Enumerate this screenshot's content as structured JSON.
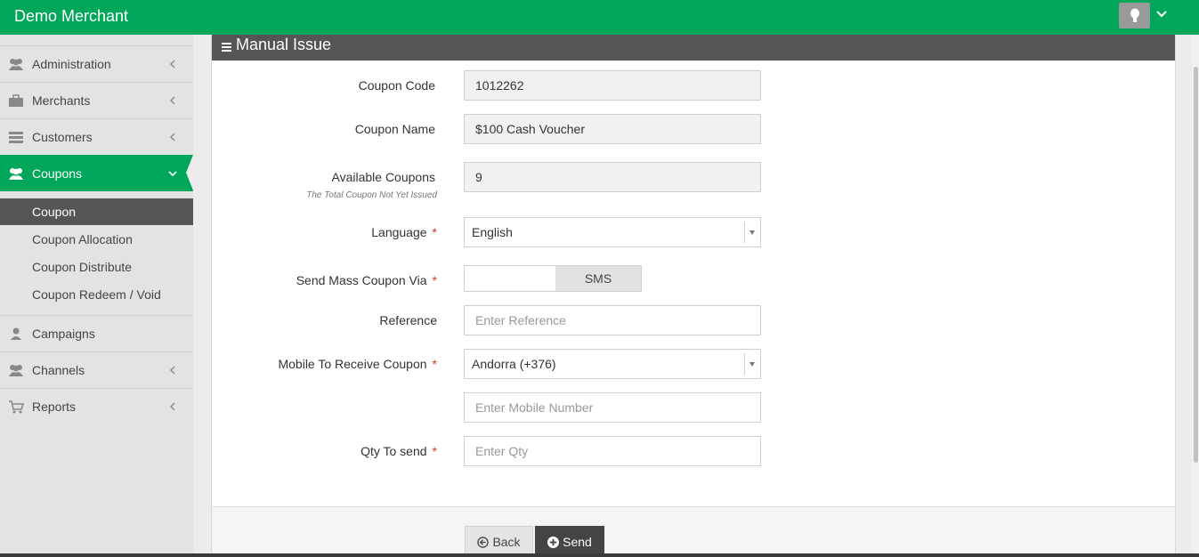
{
  "header": {
    "brand": "Demo Merchant",
    "brand_color": "#00a65a"
  },
  "sidebar": {
    "items": [
      {
        "label": "Administration",
        "icon": "users-icon"
      },
      {
        "label": "Merchants",
        "icon": "briefcase-icon"
      },
      {
        "label": "Customers",
        "icon": "list-icon"
      },
      {
        "label": "Coupons",
        "icon": "users-icon",
        "active": true
      },
      {
        "label": "Campaigns",
        "icon": "user-icon"
      },
      {
        "label": "Channels",
        "icon": "users-icon"
      },
      {
        "label": "Reports",
        "icon": "cart-icon"
      }
    ],
    "coupons_sub": [
      {
        "label": "Coupon",
        "current": true
      },
      {
        "label": "Coupon Allocation"
      },
      {
        "label": "Coupon Distribute"
      },
      {
        "label": "Coupon Redeem / Void"
      }
    ]
  },
  "panel": {
    "title": "Manual Issue"
  },
  "form": {
    "coupon_code": {
      "label": "Coupon Code",
      "value": "1012262"
    },
    "coupon_name": {
      "label": "Coupon Name",
      "value": "$100 Cash Voucher"
    },
    "available": {
      "label": "Available Coupons",
      "hint": "The Total Coupon Not Yet Issued",
      "value": "9"
    },
    "language": {
      "label": "Language",
      "value": "English"
    },
    "send_via": {
      "label": "Send Mass Coupon Via",
      "option": "SMS"
    },
    "reference": {
      "label": "Reference",
      "placeholder": "Enter Reference"
    },
    "mobile": {
      "label": "Mobile To Receive Coupon",
      "country": "Andorra (+376)",
      "placeholder": "Enter Mobile Number"
    },
    "qty": {
      "label": "Qty To send",
      "placeholder": "Enter Qty"
    },
    "required_mark": "*"
  },
  "actions": {
    "back": "Back",
    "send": "Send"
  }
}
